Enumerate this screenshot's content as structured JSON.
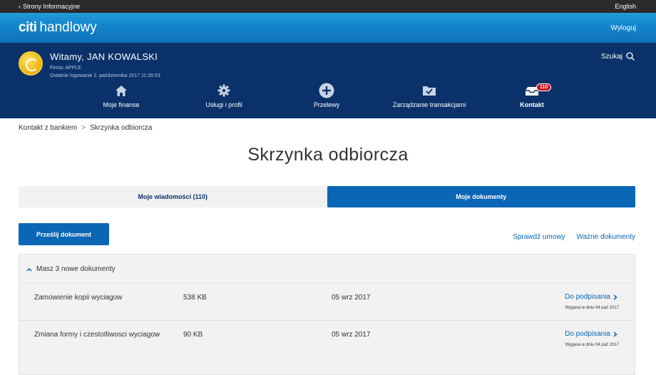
{
  "topbar": {
    "back_label": "Strony Informacyjne",
    "language": "English"
  },
  "brand": {
    "logo_citi": "citi",
    "logo_rest": "handlowy",
    "logout": "Wyloguj"
  },
  "user": {
    "greeting": "Witamy, JAN KOWALSKI",
    "company": "Firma: APPLE",
    "last_login": "Ostatnie logowanie 2. października 2017 11:35:53",
    "search_label": "Szukaj"
  },
  "nav": [
    {
      "label": "Moje finanse",
      "icon": "home-icon"
    },
    {
      "label": "Usługi i profil",
      "icon": "gear-icon"
    },
    {
      "label": "Przelewy",
      "icon": "plus-circle-icon"
    },
    {
      "label": "Zarządzanie transakcjami",
      "icon": "folder-check-icon"
    },
    {
      "label": "Kontakt",
      "icon": "inbox-icon",
      "badge": "110",
      "active": true
    }
  ],
  "breadcrumb": {
    "parent": "Kontakt z bankiem",
    "current": "Skrzynka odbiorcza"
  },
  "page_title": "Skrzynka odbiorcza",
  "tabs": [
    {
      "label": "Moje wiadomości (110)",
      "active": false
    },
    {
      "label": "Moje dokumenty",
      "active": true
    }
  ],
  "actions": {
    "send_button": "Prześlij dokument",
    "check_contracts": "Sprawdź umowy",
    "important_docs": "Ważne dokumenty"
  },
  "documents": {
    "header": "Masz 3 nowe dokumenty",
    "rows": [
      {
        "name": "Zamowienie kopii wyciagow",
        "size": "538 KB",
        "date": "05 wrz 2017",
        "action": "Do podpisania",
        "expires": "Wygasa w dniu 04 paź 2017"
      },
      {
        "name": "Zmiana formy i czestotliwosci wyciagow",
        "size": "90 KB",
        "date": "05 wrz 2017",
        "action": "Do podpisania",
        "expires": "Wygasa w dniu 04 paź 2017"
      }
    ]
  },
  "colors": {
    "brand_blue": "#0b66b5",
    "navy": "#0a3169",
    "badge_red": "#d0121b"
  }
}
